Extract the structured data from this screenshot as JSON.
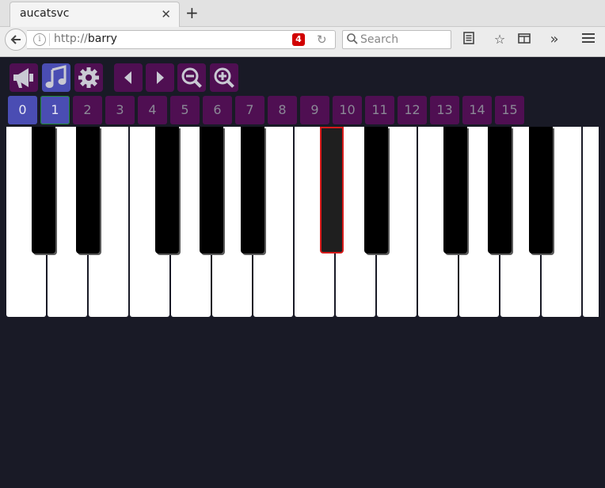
{
  "browser": {
    "tab_title": "aucatsvc",
    "url_protocol": "http://",
    "url_host": "barry",
    "badge_count": "4",
    "search_placeholder": "Search"
  },
  "toolbar": {
    "tools": [
      {
        "name": "announce",
        "icon": "megaphone-icon",
        "selected": false
      },
      {
        "name": "music",
        "icon": "music-note-icon",
        "selected": true
      },
      {
        "name": "settings",
        "icon": "gear-icon",
        "selected": false
      },
      {
        "name": "prev",
        "icon": "triangle-left-icon",
        "selected": false
      },
      {
        "name": "next",
        "icon": "triangle-right-icon",
        "selected": false
      },
      {
        "name": "zoom-out",
        "icon": "zoom-out-icon",
        "selected": false
      },
      {
        "name": "zoom-in",
        "icon": "zoom-in-icon",
        "selected": false
      }
    ]
  },
  "channels": {
    "labels": [
      "0",
      "1",
      "2",
      "3",
      "4",
      "5",
      "6",
      "7",
      "8",
      "9",
      "10",
      "11",
      "12",
      "13",
      "14",
      "15"
    ],
    "active": "0",
    "selected": "1"
  },
  "piano": {
    "white_key_count": 15,
    "highlighted_black_key_index": 5,
    "highlight_color": "#d61a1a"
  },
  "colors": {
    "page_bg": "#191a26",
    "button_bg": "#4f0f52",
    "button_selected": "#4a4db3"
  }
}
